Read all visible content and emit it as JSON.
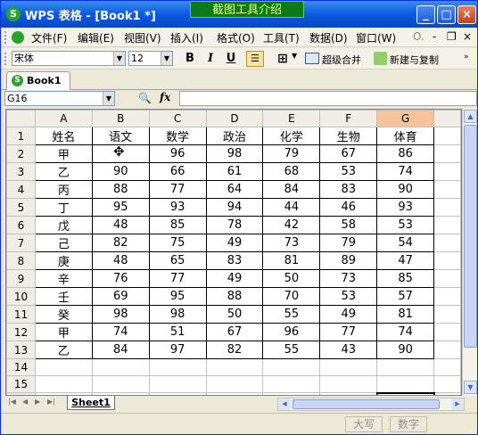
{
  "window": {
    "title": "WPS 表格 - [Book1 *]",
    "capture_tool": "截图工具介绍",
    "minimize": "_",
    "maximize": "□",
    "close": "×"
  },
  "menu": {
    "items": [
      "文件(F)",
      "编辑(E)",
      "视图(V)",
      "插入(I)",
      "格式(O)",
      "工具(T)",
      "数据(D)",
      "窗口(W)"
    ],
    "extra": "O.",
    "mdi_min": "-",
    "mdi_restore": "❐",
    "mdi_close": "×"
  },
  "toolbar": {
    "font": "宋体",
    "size": "12",
    "bold": "B",
    "italic": "I",
    "underline": "U",
    "merge": "超级合并",
    "new_copy": "新建与复制"
  },
  "doc_tab": "Book1 *",
  "formula": {
    "cell": "G16",
    "fx": "fx",
    "value": ""
  },
  "sheet": {
    "columns": [
      "A",
      "B",
      "C",
      "D",
      "E",
      "F",
      "G"
    ],
    "selected_col": "G",
    "rows": [
      [
        "1",
        "姓名",
        "语文",
        "数学",
        "政治",
        "化学",
        "生物",
        "体育"
      ],
      [
        "2",
        "甲",
        "",
        "96",
        "98",
        "79",
        "67",
        "86"
      ],
      [
        "3",
        "乙",
        "90",
        "66",
        "61",
        "68",
        "53",
        "74"
      ],
      [
        "4",
        "丙",
        "88",
        "77",
        "64",
        "84",
        "83",
        "90"
      ],
      [
        "5",
        "丁",
        "95",
        "93",
        "94",
        "44",
        "46",
        "93"
      ],
      [
        "6",
        "戊",
        "48",
        "85",
        "78",
        "42",
        "58",
        "53"
      ],
      [
        "7",
        "己",
        "82",
        "75",
        "49",
        "73",
        "79",
        "54"
      ],
      [
        "8",
        "庚",
        "48",
        "65",
        "83",
        "81",
        "89",
        "47"
      ],
      [
        "9",
        "辛",
        "76",
        "77",
        "49",
        "50",
        "73",
        "85"
      ],
      [
        "10",
        "壬",
        "69",
        "95",
        "88",
        "70",
        "53",
        "57"
      ],
      [
        "11",
        "癸",
        "98",
        "98",
        "50",
        "55",
        "49",
        "81"
      ],
      [
        "12",
        "甲",
        "74",
        "51",
        "67",
        "96",
        "77",
        "74"
      ],
      [
        "13",
        "乙",
        "84",
        "97",
        "82",
        "55",
        "43",
        "90"
      ],
      [
        "14",
        "",
        "",
        "",
        "",
        "",
        "",
        ""
      ],
      [
        "15",
        "",
        "",
        "",
        "",
        "",
        "",
        ""
      ],
      [
        "16",
        "",
        "",
        "",
        "",
        "",
        "",
        ""
      ]
    ]
  },
  "sheet_tab": "Sheet1",
  "status": {
    "caps": "大写",
    "num": "数字"
  }
}
